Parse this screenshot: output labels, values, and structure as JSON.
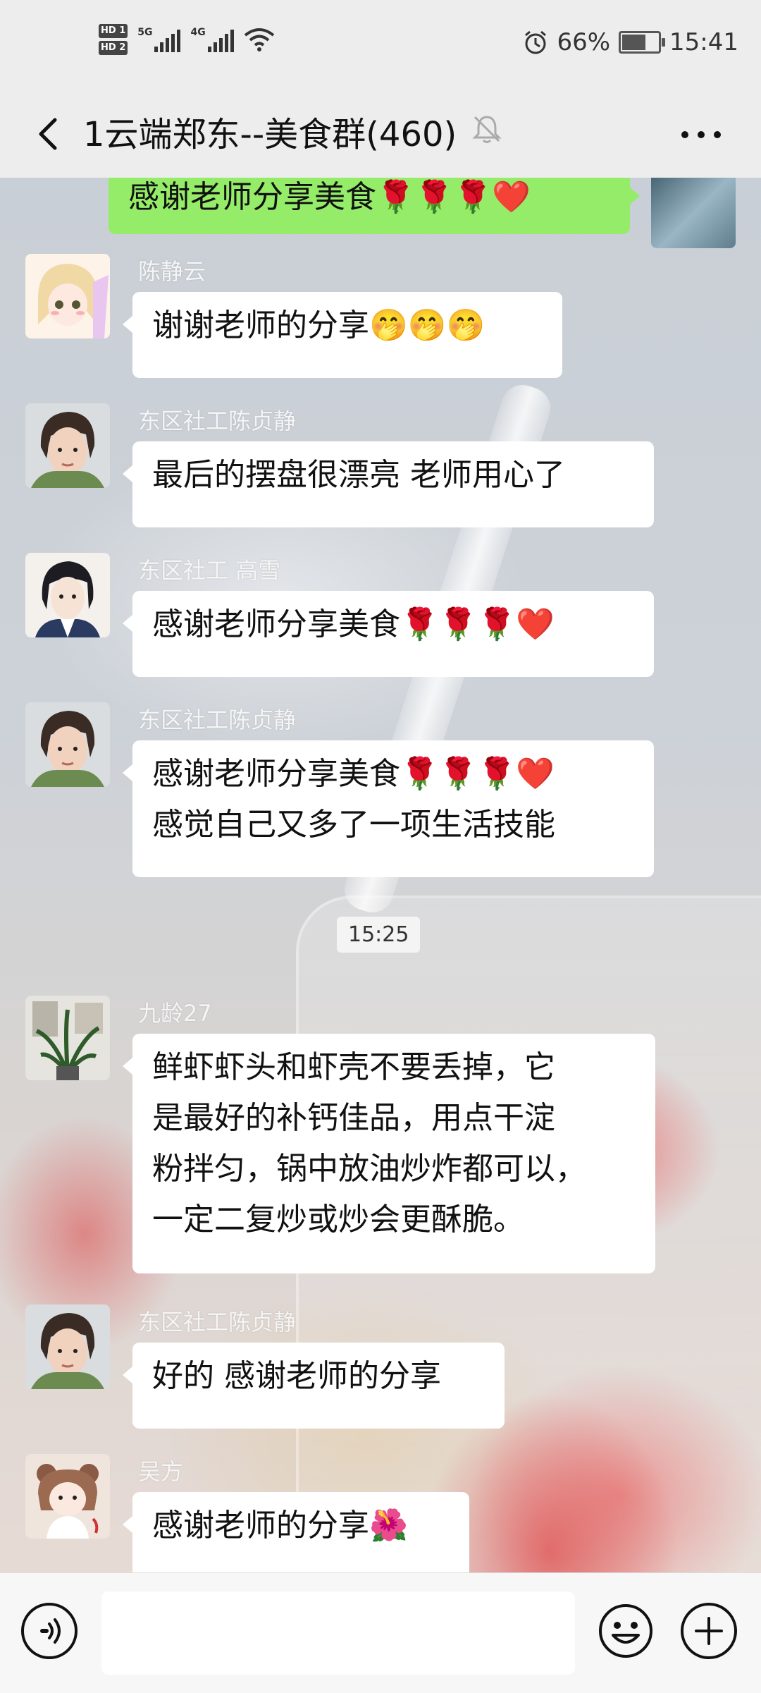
{
  "status_bar": {
    "hd_1": "HD 1",
    "hd_2": "HD 2",
    "network_1": "5G",
    "network_2": "4G",
    "battery_percent": "66%",
    "battery_level": 0.66,
    "time": "15:41"
  },
  "header": {
    "title": "1云端郑东--美食群(460)"
  },
  "messages": [
    {
      "type": "self",
      "text": "感谢老师分享美食🌹🌹🌹❤️"
    },
    {
      "type": "other",
      "sender": "陈静云",
      "text": "谢谢老师的分享🤭🤭🤭",
      "avatar_icon": "cartoon-girl-avatar"
    },
    {
      "type": "other",
      "sender": "东区社工陈贞静",
      "text": "最后的摆盘很漂亮 老师用心了",
      "avatar_icon": "woman-photo-avatar"
    },
    {
      "type": "other",
      "sender": "东区社工 高雪",
      "text": "感谢老师分享美食🌹🌹🌹❤️",
      "avatar_icon": "illustrated-woman-avatar"
    },
    {
      "type": "other",
      "sender": "东区社工陈贞静",
      "text_line1": "感谢老师分享美食🌹🌹🌹❤️",
      "text_line2": "感觉自己又多了一项生活技能",
      "avatar_icon": "woman-photo-avatar"
    },
    {
      "type": "time",
      "text": "15:25"
    },
    {
      "type": "other",
      "sender": "九龄27",
      "text_lines": [
        "鲜虾虾头和虾壳不要丢掉，它",
        "是最好的补钙佳品，用点干淀",
        "粉拌匀，锅中放油炒炸都可以，",
        "一定二复炒或炒会更酥脆。"
      ],
      "avatar_icon": "plant-photo-avatar"
    },
    {
      "type": "other",
      "sender": "东区社工陈贞静",
      "text": "好的 感谢老师的分享",
      "avatar_icon": "woman-photo-avatar"
    },
    {
      "type": "other",
      "sender": "吴方",
      "text": "感谢老师的分享🌺",
      "avatar_icon": "cartoon-bear-girl-avatar"
    }
  ],
  "input_bar": {
    "voice_icon": "voice-input-icon",
    "text_value": "",
    "emoji_icon": "emoji-icon",
    "plus_icon": "add-more-icon"
  },
  "colors": {
    "self_bubble": "#95ec69",
    "other_bubble": "#ffffff",
    "chrome": "#ededed"
  }
}
